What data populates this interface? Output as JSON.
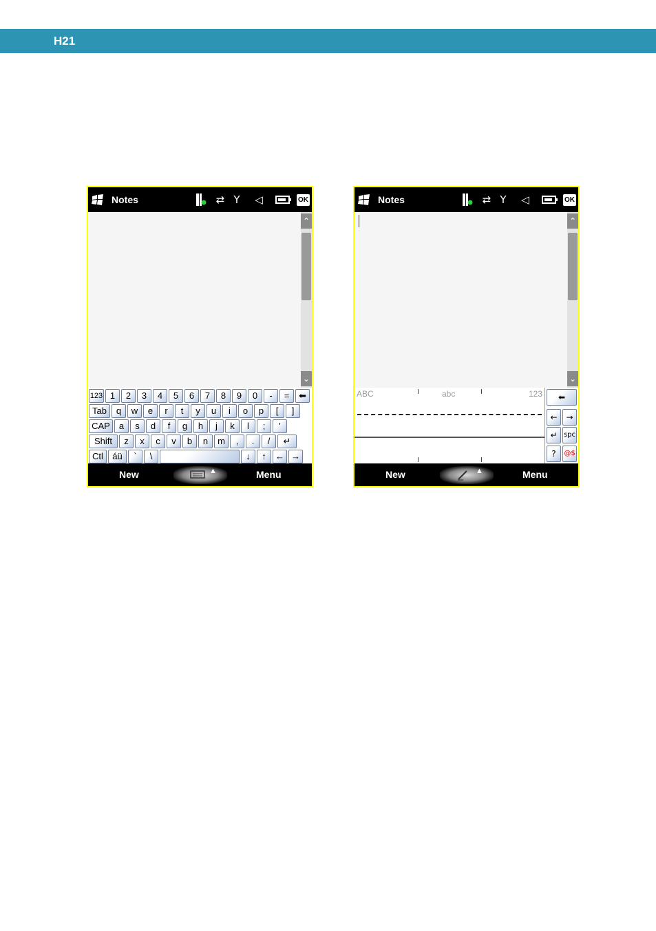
{
  "header": {
    "title": "H21"
  },
  "left_phone": {
    "app_title": "Notes",
    "status": {
      "ok": "OK"
    },
    "scroll_up": "⌃",
    "scroll_down": "⌄",
    "keyboard_rows": [
      [
        "123",
        "1",
        "2",
        "3",
        "4",
        "5",
        "6",
        "7",
        "8",
        "9",
        "0",
        "-",
        "=",
        "⬅"
      ],
      [
        "Tab",
        "q",
        "w",
        "e",
        "r",
        "t",
        "y",
        "u",
        "i",
        "o",
        "p",
        "[",
        "]"
      ],
      [
        "CAP",
        "a",
        "s",
        "d",
        "f",
        "g",
        "h",
        "j",
        "k",
        "l",
        ";",
        "'"
      ],
      [
        "Shift",
        "z",
        "x",
        "c",
        "v",
        "b",
        "n",
        "m",
        ",",
        ".",
        "/",
        "↵"
      ],
      [
        "Ctl",
        "áü",
        "`",
        "\\",
        "",
        "↓",
        "↑",
        "←",
        "→"
      ]
    ],
    "softkeys": {
      "left": "New",
      "right": "Menu"
    }
  },
  "right_phone": {
    "app_title": "Notes",
    "status": {
      "ok": "OK"
    },
    "scroll_up": "⌃",
    "scroll_down": "⌄",
    "transcriber": {
      "upper": "ABC",
      "lower": "abc",
      "numeric": "123"
    },
    "side_keys": {
      "backspace": "⬅",
      "left": "←",
      "right": "→",
      "enter": "↵",
      "space": "spc",
      "help": "?",
      "symbols": "@$"
    },
    "softkeys": {
      "left": "New",
      "right": "Menu"
    }
  },
  "icons": [
    "windows-logo-icon",
    "battery-charge-icon",
    "sync-arrows-icon",
    "signal-antenna-icon",
    "volume-muted-icon",
    "battery-icon",
    "keyboard-icon",
    "pen-icon"
  ]
}
